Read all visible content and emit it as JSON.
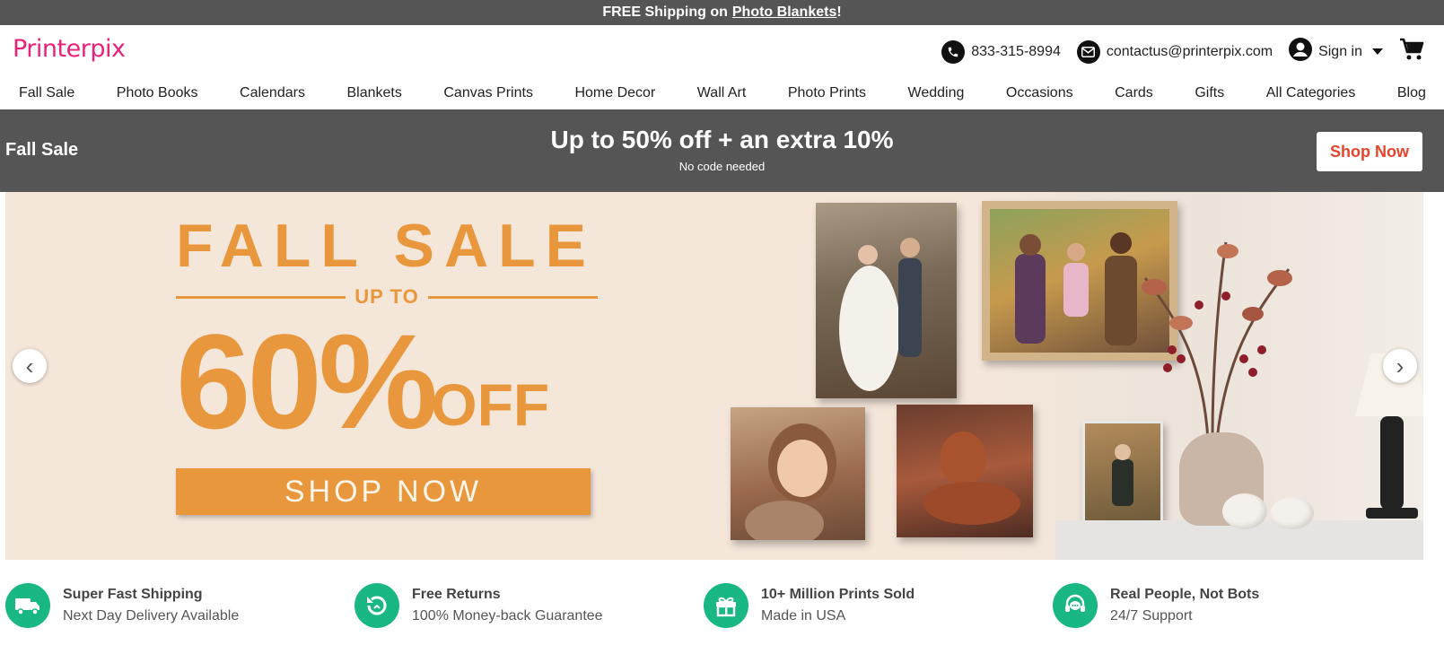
{
  "top_bar": {
    "prefix": "FREE Shipping on",
    "link": "Photo Blankets",
    "suffix": "!"
  },
  "header": {
    "logo": "Printerpix",
    "phone": "833-315-8994",
    "email": "contactus@printerpix.com",
    "sign_in": "Sign in"
  },
  "nav": {
    "items": [
      "Fall Sale",
      "Photo Books",
      "Calendars",
      "Blankets",
      "Canvas Prints",
      "Home Decor",
      "Wall Art",
      "Photo Prints",
      "Wedding",
      "Occasions",
      "Cards",
      "Gifts",
      "All Categories",
      "Blog"
    ]
  },
  "promo": {
    "left": "Fall Sale",
    "title": "Up to 50% off + an extra 10%",
    "subtitle": "No code needed",
    "button": "Shop Now"
  },
  "hero": {
    "headline": "FALL SALE",
    "upto": "UP TO",
    "percent": "60%",
    "off": "OFF",
    "button": "SHOP NOW",
    "prev": "‹",
    "next": "›"
  },
  "features": [
    {
      "icon": "truck-icon",
      "title": "Super Fast Shipping",
      "subtitle": "Next Day Delivery Available"
    },
    {
      "icon": "returns-icon",
      "title": "Free Returns",
      "subtitle": "100% Money-back Guarantee"
    },
    {
      "icon": "gift-icon",
      "title": "10+ Million Prints Sold",
      "subtitle": "Made in USA"
    },
    {
      "icon": "support-icon",
      "title": "Real People, Not Bots",
      "subtitle": "24/7 Support"
    }
  ],
  "colors": {
    "brand_pink": "#e8227a",
    "dark_bar": "#555555",
    "hero_orange": "#e9973c",
    "hero_bg": "#f5e6da",
    "feature_green": "#18b783",
    "shop_now_red": "#e8432b"
  }
}
